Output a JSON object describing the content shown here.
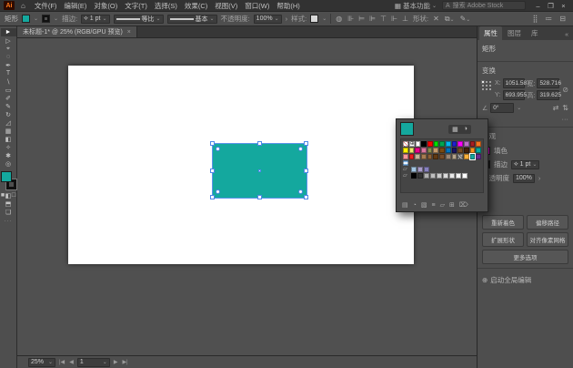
{
  "colors": {
    "accent_teal": "#14A89E",
    "fill_magenta": "#FF00F0",
    "selection_blue": "#4F87E8"
  },
  "menubar": {
    "logo": "Ai",
    "home_icon": "⌂",
    "items": [
      "文件(F)",
      "编辑(E)",
      "对象(O)",
      "文字(T)",
      "选择(S)",
      "效果(C)",
      "视图(V)",
      "窗口(W)",
      "帮助(H)"
    ],
    "workspace_icon": "▦",
    "workspace": "基本功能",
    "search_icon": "A",
    "search_placeholder": "搜索 Adobe Stock",
    "window_controls": [
      "–",
      "❐",
      "×"
    ]
  },
  "controlbar": {
    "selection_type": "矩形",
    "stroke_label": "描边:",
    "stroke_weight": "1 pt",
    "profile_label": "等比",
    "brush_label": "基本",
    "opacity_label": "不透明度:",
    "opacity_value": "100%",
    "style_label": "样式:",
    "align_icons": [
      "⊪",
      "⊨",
      "⊫",
      "⊤",
      "⊩",
      "⊥"
    ],
    "shape_label": "形状:",
    "right_icons": [
      "⣿",
      "≔",
      "⊟"
    ]
  },
  "toolbar": {
    "tools": [
      {
        "name": "selection-tool",
        "glyph": "►",
        "selected": true
      },
      {
        "name": "direct-selection-tool",
        "glyph": "▷",
        "selected": false
      },
      {
        "name": "magic-wand-tool",
        "glyph": "⌖",
        "selected": false
      },
      {
        "name": "lasso-tool",
        "glyph": "◌",
        "selected": false
      },
      {
        "name": "pen-tool",
        "glyph": "✒",
        "selected": false
      },
      {
        "name": "type-tool",
        "glyph": "T",
        "selected": false
      },
      {
        "name": "line-segment-tool",
        "glyph": "∖",
        "selected": false
      },
      {
        "name": "rectangle-tool",
        "glyph": "▭",
        "selected": false
      },
      {
        "name": "paintbrush-tool",
        "glyph": "✐",
        "selected": false
      },
      {
        "name": "pencil-tool",
        "glyph": "✎",
        "selected": false
      },
      {
        "name": "rotate-tool",
        "glyph": "↻",
        "selected": false
      },
      {
        "name": "scale-tool",
        "glyph": "◿",
        "selected": false
      },
      {
        "name": "mesh-tool",
        "glyph": "▦",
        "selected": false
      },
      {
        "name": "gradient-tool",
        "glyph": "◧",
        "selected": false
      },
      {
        "name": "eyedropper-tool",
        "glyph": "✧",
        "selected": false
      },
      {
        "name": "hand-tool",
        "glyph": "✱",
        "selected": false
      },
      {
        "name": "zoom-tool",
        "glyph": "◎",
        "selected": false
      }
    ],
    "edit-toolbar-dots": "···"
  },
  "document": {
    "tab_title": "未标题-1* @ 25% (RGB/GPU 预览)",
    "tab_close": "×"
  },
  "swatches_popup": {
    "view_icons": [
      "▦",
      "◑"
    ],
    "rows": [
      [
        "none",
        "reg",
        "#FFFFFF",
        "#000000",
        "#FF0000",
        "#00E000",
        "#00A651",
        "#00B7EF",
        "#2121CE",
        "#FF00FF",
        "#B86FC6",
        "#A81E22",
        "#F47421"
      ],
      [
        "#FFF200",
        "#EFE86B",
        "#EC008C",
        "#D9779F",
        "#8A8C4E",
        "#C49A6C",
        "#7B4A12",
        "#0072BC",
        "#1B1464",
        "#754C24",
        "#42210B",
        "#F7941E",
        "#00A99D"
      ],
      [
        "#F5989D",
        "#ED1C24",
        "#C7B299",
        "#A67C52",
        "#8C6239",
        "#603913",
        "#754C29",
        "#998675",
        "#B5A58C",
        "pattern",
        "#FBB03B",
        "sel:#14A89E",
        "#662D91"
      ]
    ],
    "pattern_row": [
      "pattern-blue"
    ],
    "groups": [
      {
        "folder_icon": "▱",
        "colors": [
          "#A2C4E0",
          "#A89CC8",
          "#8781BD"
        ]
      },
      {
        "folder_icon": "▱",
        "colors": [
          "#000000",
          "#333333",
          "#B0B0B0",
          "#BEBEBE",
          "#CCCCCC",
          "#DADADA",
          "#E8E8E8",
          "#F4F4F4",
          "#FFFFFF"
        ]
      }
    ],
    "footer_icons": [
      {
        "name": "swatch-libraries-icon",
        "glyph": "▤"
      },
      {
        "name": "add-from-cc-icon",
        "glyph": "◔"
      },
      {
        "name": "show-kinds-icon",
        "glyph": "▧"
      },
      {
        "name": "swatch-options-icon",
        "glyph": "≡"
      },
      {
        "name": "new-color-group-icon",
        "glyph": "▱"
      },
      {
        "name": "new-swatch-icon",
        "glyph": "⊞"
      },
      {
        "name": "delete-swatch-icon",
        "glyph": "⌦"
      }
    ]
  },
  "properties": {
    "tabs": [
      {
        "label": "属性",
        "active": true
      },
      {
        "label": "图层",
        "active": false
      },
      {
        "label": "库",
        "active": false
      }
    ],
    "collapse_icon": "«",
    "selection_type": "矩形",
    "transform": {
      "header": "变换",
      "x_label": "X:",
      "x": "1051.587",
      "y_label": "Y:",
      "y": "693.955",
      "w_label": "宽:",
      "w": "528.716",
      "h_label": "高:",
      "h": "319.625",
      "link_icon": "⊘",
      "angle_icon": "∠",
      "angle": "0°",
      "flip_h_icon": "⇄",
      "flip_v_icon": "⇅",
      "more_dots": "···"
    },
    "appearance": {
      "header": "外观",
      "fill_label": "填色",
      "stroke_label": "描边",
      "stroke_weight": "1 pt",
      "opacity_label": "不透明度",
      "opacity_value": "100%",
      "opacity_arrow": "›"
    },
    "quick_actions": {
      "buttons": [
        "重新着色",
        "偏移路径",
        "扩展形状",
        "对齐像素网格"
      ],
      "more_label": "更多选项",
      "global_edit_icon": "⊕",
      "global_edit_label": "启动全局编辑"
    }
  },
  "statusbar": {
    "zoom": "25%",
    "nav_first": "|◀",
    "nav_prev": "◀",
    "artboard": "1",
    "nav_next": "▶",
    "nav_last": "▶|"
  }
}
